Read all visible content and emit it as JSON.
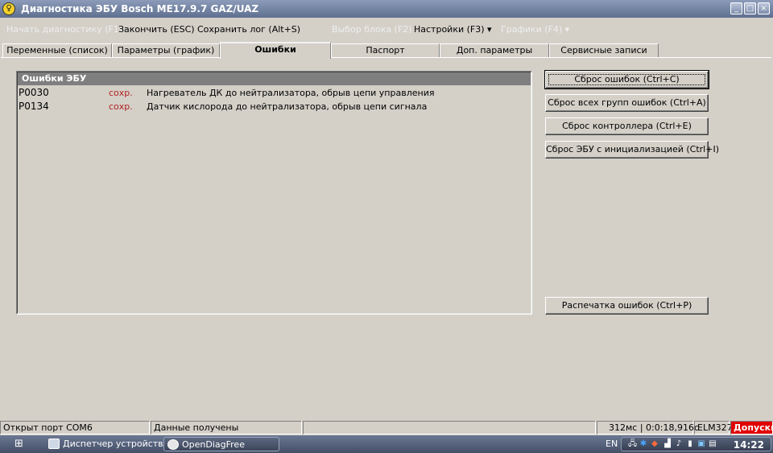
{
  "window": {
    "title": "Диагностика ЭБУ Bosch ME17.9.7 GAZ/UAZ",
    "controls": [
      "_",
      "□",
      "×"
    ]
  },
  "menu": {
    "items": [
      {
        "label": "Начать диагностику (F1)",
        "disabled": true
      },
      {
        "label": "Закончить (ESC)",
        "disabled": false
      },
      {
        "label": "Сохранить лог (Alt+S)",
        "disabled": false
      },
      {
        "label": "Выбор блока (F2)",
        "disabled": true
      },
      {
        "label": "Настройки (F3) ▾",
        "disabled": false
      },
      {
        "label": "Графики (F4) ▾",
        "disabled": true
      }
    ]
  },
  "tabs": [
    {
      "label": "Переменные (список)"
    },
    {
      "label": "Параметры (график)"
    },
    {
      "label": "Ошибки",
      "active": true
    },
    {
      "label": "Паспорт"
    },
    {
      "label": "Доп. параметры"
    },
    {
      "label": "Сервисные записи"
    }
  ],
  "errors": {
    "header": "Ошибки ЭБУ",
    "rows": [
      {
        "code": "P0030",
        "status": "сохр.",
        "description": "Нагреватель ДК до нейтрализатора, обрыв цепи управления"
      },
      {
        "code": "P0134",
        "status": "сохр.",
        "description": "Датчик кислорода до нейтрализатора, обрыв цепи сигнала"
      }
    ]
  },
  "buttons": {
    "reset_errors": "Сброс ошибок (Ctrl+C)",
    "reset_all_groups": "Сброс всех групп ошибок (Ctrl+A)",
    "reset_controller": "Сброс контроллера (Ctrl+E)",
    "reset_ecu_init": "Сброс ЭБУ с инициализацией (Ctrl+I)",
    "print_errors": "Распечатка ошибок (Ctrl+P)"
  },
  "status": {
    "port": "Открыт порт COM6",
    "data": "Данные получены",
    "timing": "312мс | 0:0:18,916с",
    "adapter": "ELM327",
    "alert": "Допуски"
  },
  "taskbar": {
    "tasks": [
      {
        "label": "Диспетчер устройств"
      },
      {
        "label": "OpenDiagFree",
        "active": true
      }
    ],
    "lang": "EN",
    "clock": "14:22"
  },
  "colors": {
    "accent": "#7f7f7f",
    "error_status": "#b22222",
    "alert": "#e00000"
  }
}
